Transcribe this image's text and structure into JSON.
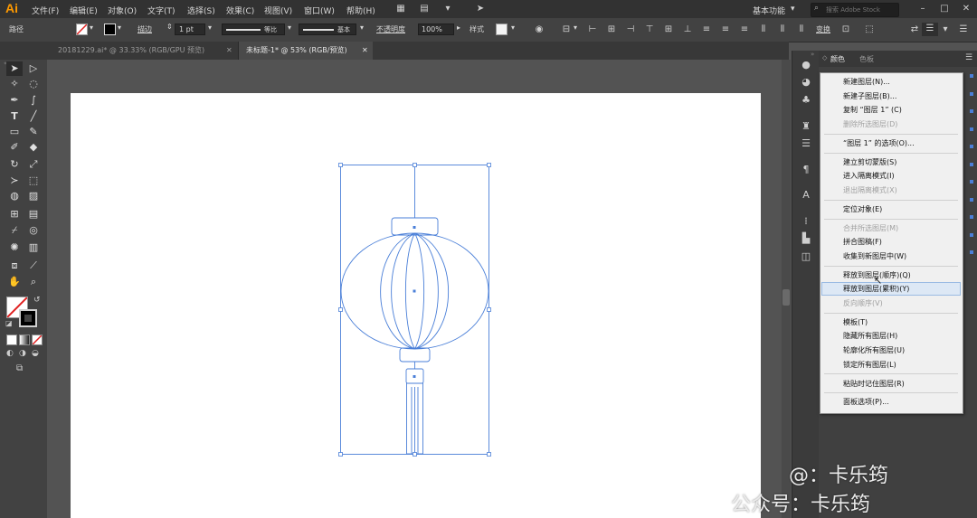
{
  "app": {
    "logo": "Ai"
  },
  "menubar": {
    "items": [
      "文件(F)",
      "编辑(E)",
      "对象(O)",
      "文字(T)",
      "选择(S)",
      "效果(C)",
      "视图(V)",
      "窗口(W)",
      "帮助(H)"
    ],
    "workspace": "基本功能",
    "search_placeholder": "搜索 Adobe Stock"
  },
  "controlbar": {
    "path_label": "路径",
    "stroke_label": "描边",
    "stroke_weight": "1 pt",
    "stroke_profile": "等比",
    "brush": "基本",
    "opacity_label": "不透明度",
    "opacity_value": "100%",
    "style_label": "样式",
    "transform_label": "变换"
  },
  "tabs": [
    {
      "label": "20181229.ai* @ 33.33% (RGB/GPU 预览)",
      "active": false
    },
    {
      "label": "未标题-1* @ 53% (RGB/预览)",
      "active": true
    }
  ],
  "panel": {
    "tabs": [
      "颜色",
      "色板"
    ]
  },
  "context_menu": {
    "highlighted_index": 13,
    "groups": [
      [
        {
          "label": "新建图层(N)...",
          "enabled": true
        },
        {
          "label": "新建子图层(B)...",
          "enabled": true
        },
        {
          "label": "复制 “图层 1” (C)",
          "enabled": true
        },
        {
          "label": "删除所选图层(D)",
          "enabled": false
        }
      ],
      [
        {
          "label": "“图层 1” 的选项(O)...",
          "enabled": true
        }
      ],
      [
        {
          "label": "建立剪切蒙版(S)",
          "enabled": true
        },
        {
          "label": "进入隔离模式(I)",
          "enabled": true
        },
        {
          "label": "退出隔离模式(X)",
          "enabled": false
        }
      ],
      [
        {
          "label": "定位对象(E)",
          "enabled": true
        }
      ],
      [
        {
          "label": "合并所选图层(M)",
          "enabled": false
        },
        {
          "label": "拼合图稿(F)",
          "enabled": true
        },
        {
          "label": "收集到新图层中(W)",
          "enabled": true
        }
      ],
      [
        {
          "label": "释放到图层(顺序)(Q)",
          "enabled": true
        },
        {
          "label": "释放到图层(累积)(Y)",
          "enabled": true
        },
        {
          "label": "反向顺序(V)",
          "enabled": false
        }
      ],
      [
        {
          "label": "模板(T)",
          "enabled": true
        },
        {
          "label": "隐藏所有图层(H)",
          "enabled": true
        },
        {
          "label": "轮廓化所有图层(U)",
          "enabled": true
        },
        {
          "label": "锁定所有图层(L)",
          "enabled": true
        }
      ],
      [
        {
          "label": "粘贴时记住图层(R)",
          "enabled": true
        }
      ],
      [
        {
          "label": "面板选项(P)...",
          "enabled": true
        }
      ]
    ]
  },
  "watermark": {
    "line1": "@：卡乐筠",
    "line2": "公众号：卡乐筠"
  },
  "colors": {
    "selection_blue": "#4a7fd8",
    "menu_highlight": "#dde8f5",
    "accent_logo": "#ff9a00"
  }
}
